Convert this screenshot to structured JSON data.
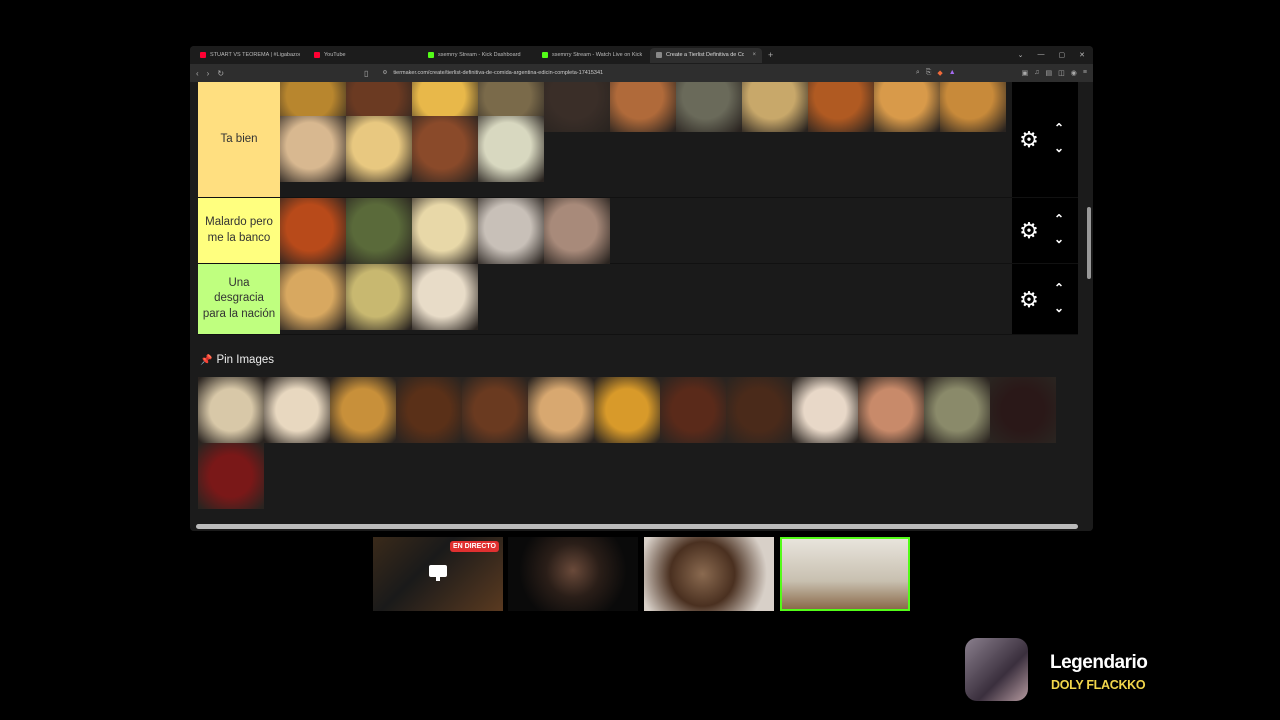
{
  "browser": {
    "tabs": [
      {
        "label": "STUART VS TEOREMA | #Ligabazoo...",
        "color": "#ff0033",
        "active": false
      },
      {
        "label": "YouTube",
        "color": "#ff0033",
        "active": false
      },
      {
        "label": "ssemrry Stream - Kick Dashboard",
        "color": "#53fc18",
        "active": false
      },
      {
        "label": "ssemrry Stream - Watch Live on Kick",
        "color": "#53fc18",
        "active": false
      },
      {
        "label": "Create a Tierlist Definitiva de Co...",
        "color": "#888888",
        "active": true
      }
    ],
    "new_tab": "+",
    "url": "tiermaker.com/create/tierlist-definitiva-de-comida-argentina-edicin-completa-17415341"
  },
  "tiers": [
    {
      "label": "Ta bien",
      "color": "#ffdf80",
      "tiles": [
        "#b8862e",
        "#6b3a22",
        "#e8b84a",
        "#7a6a4a",
        "#3a2e28",
        "#b06a3a",
        "#6a6a5a",
        "#c8a86a",
        "#b05a22",
        "#d89a4a",
        "#c88a3a",
        "#d8b890",
        "#e8c880",
        "#8a4a2a",
        "#d8d8c0"
      ]
    },
    {
      "label": "Malardo pero me la banco",
      "color": "#ffff7f",
      "tiles": [
        "#b84a1a",
        "#5a6a3a",
        "#e8d8a8",
        "#c8c0b8",
        "#a88a7a"
      ]
    },
    {
      "label": "Una desgracia para la nación",
      "color": "#bfff7f",
      "tiles": [
        "#d8a860",
        "#c8b870",
        "#e8dcc8"
      ]
    }
  ],
  "pin_images": {
    "title": "Pin Images",
    "tiles": [
      "#d8c8a8",
      "#e8d8c0",
      "#c8903a",
      "#5a3018",
      "#6a3a20",
      "#d8a870",
      "#d89a2a",
      "#5a2a1a",
      "#4a2a1a",
      "#e8d8c8",
      "#c88a6a",
      "#8a8a6a",
      "#2a1818",
      "#7a1818"
    ]
  },
  "stream": {
    "live_badge": "EN DIRECTO",
    "overlay_name": "Legendario",
    "overlay_sub": "DOLY FLACKKO"
  }
}
